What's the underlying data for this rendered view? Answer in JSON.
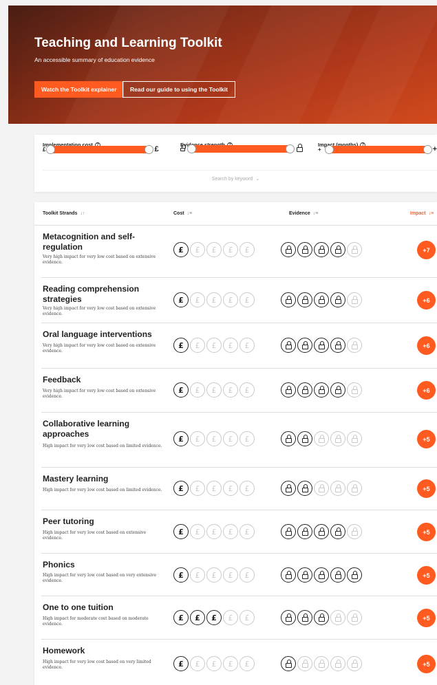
{
  "hero": {
    "title": "Teaching and Learning Toolkit",
    "subtitle": "An accessible summary of education evidence",
    "btn_explainer": "Watch the Toolkit explainer",
    "btn_guide": "Read our guide to using the Toolkit"
  },
  "filters": {
    "cost": {
      "label": "Implementation cost",
      "min": "£",
      "max": "£"
    },
    "evidence": {
      "label": "Evidence strength"
    },
    "impact": {
      "label": "Impact (months)",
      "min": "+",
      "max": "+"
    },
    "search_toggle": "Search by keyword"
  },
  "table": {
    "headers": {
      "strand": "Toolkit Strands",
      "cost": "Cost",
      "evidence": "Evidence",
      "impact": "Impact"
    },
    "rows": [
      {
        "title": "Metacognition and self-regulation",
        "desc": "Very high impact for very low cost based on extensive evidence.",
        "cost": 1,
        "evidence": 4,
        "impact": "+7"
      },
      {
        "title": "Reading comprehension strategies",
        "desc": "Very high impact for very low cost based on extensive evidence.",
        "cost": 1,
        "evidence": 4,
        "impact": "+6"
      },
      {
        "title": "Oral language interventions",
        "desc": "Very high impact for very low cost based on extensive evidence.",
        "cost": 1,
        "evidence": 4,
        "impact": "+6"
      },
      {
        "title": "Feedback",
        "desc": "Very high impact for very low cost based on extensive evidence.",
        "cost": 1,
        "evidence": 4,
        "impact": "+6"
      },
      {
        "title": "Collaborative learning approaches",
        "desc": "High impact for very low cost based on limited evidence.",
        "cost": 1,
        "evidence": 2,
        "impact": "+5"
      },
      {
        "title": "Mastery learning",
        "desc": "High impact for very low cost based on limited evidence.",
        "cost": 1,
        "evidence": 2,
        "impact": "+5"
      },
      {
        "title": "Peer tutoring",
        "desc": "High impact for very low cost based on extensive evidence.",
        "cost": 1,
        "evidence": 4,
        "impact": "+5"
      },
      {
        "title": "Phonics",
        "desc": "High impact for very low cost based on very extensive evidence.",
        "cost": 1,
        "evidence": 5,
        "impact": "+5"
      },
      {
        "title": "One to one tuition",
        "desc": "High impact for moderate cost based on moderate evidence.",
        "cost": 3,
        "evidence": 3,
        "impact": "+5"
      },
      {
        "title": "Homework",
        "desc": "High impact for very low cost based on very limited evidence.",
        "cost": 1,
        "evidence": 1,
        "impact": "+5"
      }
    ]
  },
  "colors": {
    "accent": "#ff5a1f",
    "icon_on": "#222222",
    "icon_off": "#c9c9c9"
  }
}
